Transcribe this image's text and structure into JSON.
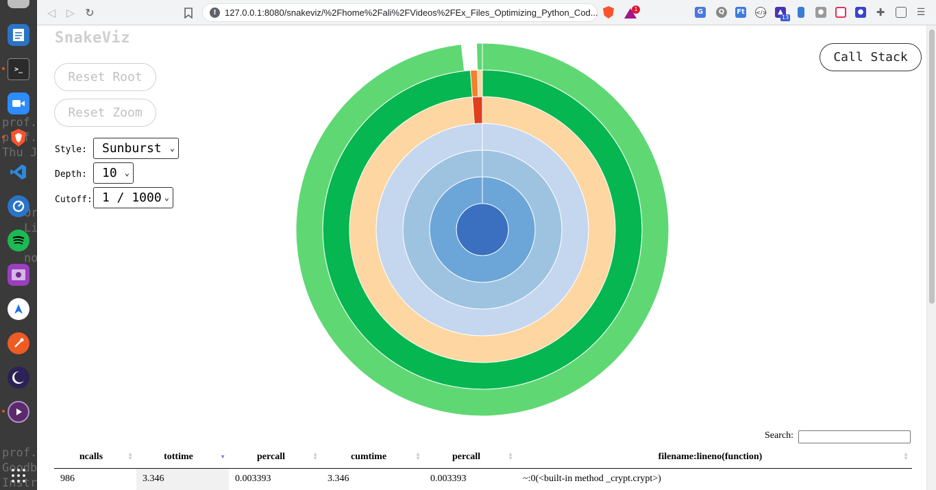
{
  "browser": {
    "url": "127.0.0.1:8080/snakeviz/%2Fhome%2Fali%2FVideos%2FEx_Files_Optimizing_Python_Cod...",
    "rewards_badge": "1",
    "ext_badge": "13"
  },
  "dock": {
    "ghost_text": [
      "prof.",
      "prof.",
      "Thu J",
      "Or",
      "Li",
      "no",
      "prof.",
      "Goodb",
      "Instr"
    ],
    "apps": [
      "text-editor",
      "terminal",
      "zoom",
      "brave",
      "vscode",
      "timer",
      "spotify",
      "screen-recorder",
      "maps",
      "postman",
      "eclipse",
      "media-player",
      "show-applications"
    ]
  },
  "app": {
    "title": "SnakeViz",
    "reset_root": "Reset Root",
    "reset_zoom": "Reset Zoom",
    "style_label": "Style:",
    "style_value": "Sunburst",
    "depth_label": "Depth:",
    "depth_value": "10",
    "cutoff_label": "Cutoff:",
    "cutoff_value": "1 / 1000",
    "call_stack": "Call Stack"
  },
  "sunburst": {
    "rings": [
      {
        "color": "#3a70bf"
      },
      {
        "color": "#6ca5d8"
      },
      {
        "color": "#9dc3e0"
      },
      {
        "color": "#c5d7ee"
      },
      {
        "color": "#fdd6a1",
        "slivers": [
          {
            "color": "#e03e1e",
            "share": 0.012
          }
        ]
      },
      {
        "color": "#06b651",
        "slivers": [
          {
            "color": "#f57f2b",
            "share": 0.007
          },
          {
            "color": "#fdd6a1",
            "share": 0.005
          }
        ]
      },
      {
        "color": "#5fd874",
        "slivers": [
          {
            "color": "#ffffff",
            "share": 0.013
          },
          {
            "color": "#5fd874",
            "share": 0.005
          }
        ]
      }
    ]
  },
  "table": {
    "search_label": "Search:",
    "headers": [
      "ncalls",
      "tottime",
      "percall",
      "cumtime",
      "percall",
      "filename:lineno(function)"
    ],
    "sorted_column": 1,
    "rows": [
      [
        "986",
        "3.346",
        "0.003393",
        "3.346",
        "0.003393",
        "~:0(<built-in method _crypt.crypt>)"
      ]
    ]
  }
}
